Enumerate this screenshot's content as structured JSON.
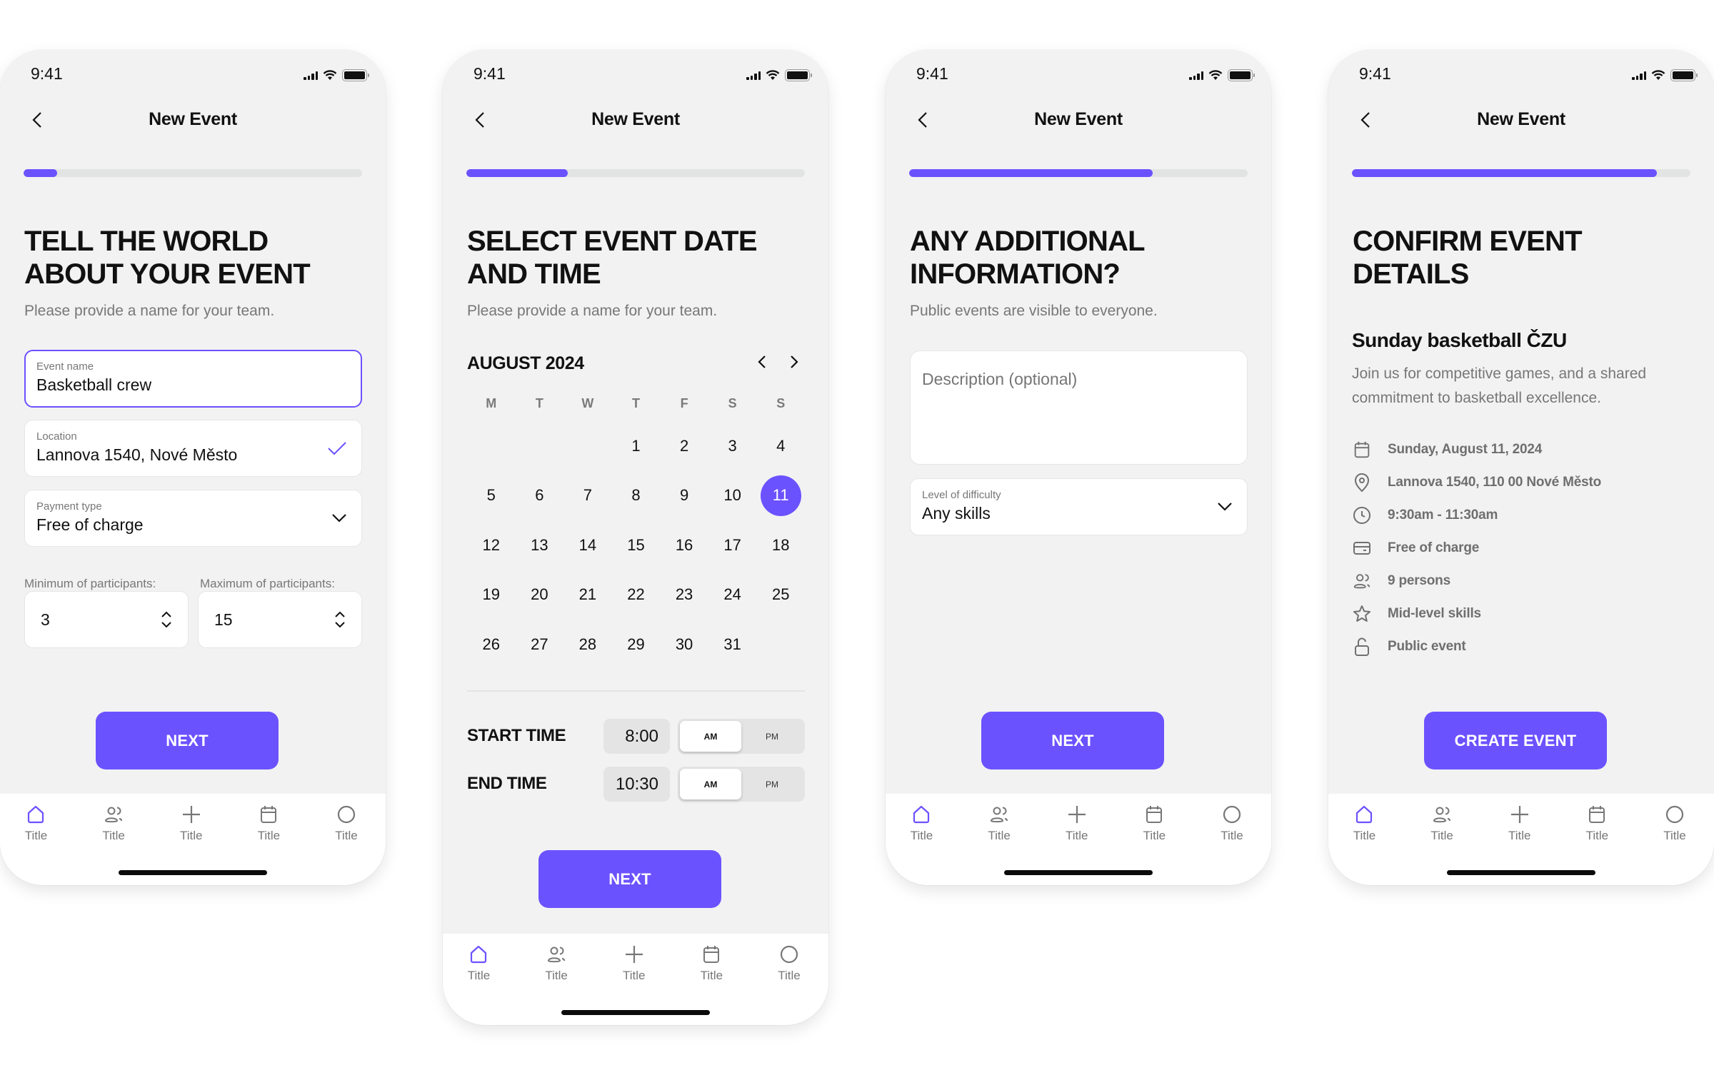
{
  "status_bar": {
    "time": "9:41"
  },
  "nav": {
    "title": "New Event"
  },
  "colors": {
    "accent": "#6b52ff",
    "track": "#e2e3e3",
    "background": "#f2f2f2"
  },
  "tabbar": {
    "items": [
      {
        "label": "Title",
        "icon": "home-icon",
        "active": true
      },
      {
        "label": "Title",
        "icon": "users-icon",
        "active": false
      },
      {
        "label": "Title",
        "icon": "plus-icon",
        "active": false
      },
      {
        "label": "Title",
        "icon": "calendar-icon",
        "active": false
      },
      {
        "label": "Title",
        "icon": "circle-icon",
        "active": false
      }
    ]
  },
  "screens": [
    {
      "progress_percent": 10,
      "heading": "Tell the world about your event",
      "subtitle": "Please provide a name for your team.",
      "fields": {
        "event_name": {
          "label": "Event name",
          "value": "Basketball crew"
        },
        "location": {
          "label": "Location",
          "value": "Lannova 1540, Nové Město"
        },
        "payment": {
          "label": "Payment type",
          "value": "Free of charge"
        },
        "min_participants": {
          "label": "Minimum of participants:",
          "value": "3"
        },
        "max_participants": {
          "label": "Maximum of participants:",
          "value": "15"
        }
      },
      "cta": "NEXT"
    },
    {
      "progress_percent": 30,
      "heading": "Select event date and time",
      "subtitle": "Please provide a name for your team.",
      "calendar": {
        "month_label": "AUGUST 2024",
        "weekdays": [
          "M",
          "T",
          "W",
          "T",
          "F",
          "S",
          "S"
        ],
        "weeks": [
          [
            "",
            "",
            "",
            "1",
            "2",
            "3",
            "4"
          ],
          [
            "5",
            "6",
            "7",
            "8",
            "9",
            "10",
            "11"
          ],
          [
            "12",
            "13",
            "14",
            "15",
            "16",
            "17",
            "18"
          ],
          [
            "19",
            "20",
            "21",
            "22",
            "23",
            "24",
            "25"
          ],
          [
            "26",
            "27",
            "28",
            "29",
            "30",
            "31",
            ""
          ]
        ],
        "selected_day": "11"
      },
      "start_time": {
        "label": "START TIME",
        "value": "8:00",
        "am": "AM",
        "pm": "PM",
        "selected": "AM"
      },
      "end_time": {
        "label": "END TIME",
        "value": "10:30",
        "am": "AM",
        "pm": "PM",
        "selected": "AM"
      },
      "cta": "NEXT"
    },
    {
      "progress_percent": 72,
      "heading": "Any additional information?",
      "subtitle": "Public events are visible to everyone.",
      "description": {
        "placeholder": "Description (optional)",
        "value": ""
      },
      "difficulty": {
        "label": "Level of difficulty",
        "value": "Any skills"
      },
      "cta": "NEXT"
    },
    {
      "progress_percent": 90,
      "heading": "Confirm event details",
      "event_title": "Sunday basketball ČZU",
      "event_description": "Join us for competitive games, and a shared commitment to basketball excellence.",
      "details": [
        {
          "icon": "calendar-icon",
          "text": "Sunday, August 11, 2024"
        },
        {
          "icon": "location-pin-icon",
          "text": "Lannova 1540, 110 00 Nové Město"
        },
        {
          "icon": "clock-icon",
          "text": "9:30am - 11:30am"
        },
        {
          "icon": "credit-card-icon",
          "text": "Free of charge"
        },
        {
          "icon": "users-icon",
          "text": "9 persons"
        },
        {
          "icon": "star-icon",
          "text": "Mid-level skills"
        },
        {
          "icon": "unlock-icon",
          "text": "Public event"
        }
      ],
      "cta": "CREATE EVENT"
    }
  ]
}
